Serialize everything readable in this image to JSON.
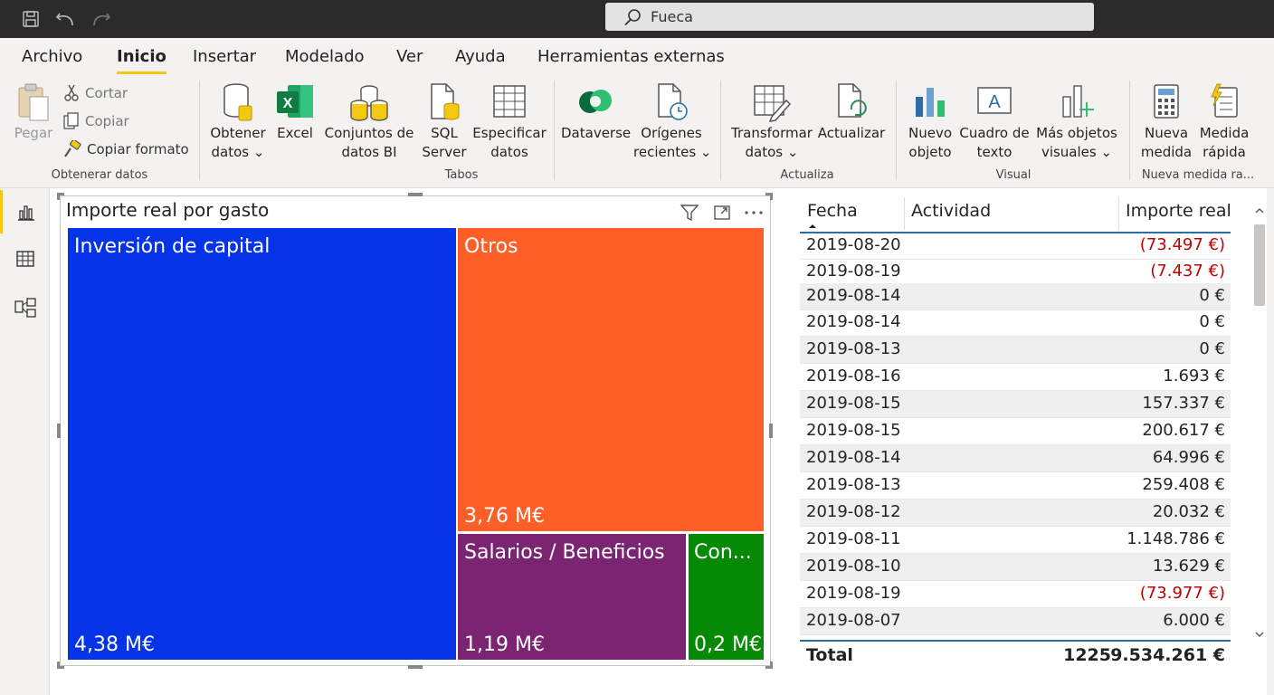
{
  "titlebar": {
    "search_text": "Fueca",
    "icons": [
      "save-icon",
      "undo-icon",
      "redo-icon",
      "search-icon"
    ]
  },
  "menu": {
    "tabs": [
      "Archivo",
      "Inicio",
      "Insertar",
      "Modelado",
      "Ver",
      "Ayuda",
      "Herramientas externas"
    ],
    "active": "Inicio"
  },
  "ribbon": {
    "clipboard": {
      "paste": "Pegar",
      "cut": "Cortar",
      "copy": "Copiar",
      "format_painter": "Copiar formato"
    },
    "get_data": {
      "l1": "Obtener",
      "l2": "datos ⌄"
    },
    "excel": "Excel",
    "datasets": {
      "l1": "Conjuntos de",
      "l2": "datos BI"
    },
    "sql": {
      "l1": "SQL",
      "l2": "Server"
    },
    "enter_data": {
      "l1": "Especificar",
      "l2": "datos"
    },
    "dataverse": "Dataverse",
    "recent": {
      "l1": "Orígenes",
      "l2": "recientes ⌄"
    },
    "transform": {
      "l1": "Transformar",
      "l2": "datos ⌄"
    },
    "refresh": "Actualizar",
    "new_visual": {
      "l1": "Nuevo",
      "l2": "objeto"
    },
    "textbox": {
      "l1": "Cuadro de",
      "l2": "texto"
    },
    "more_visuals": {
      "l1": "Más objetos",
      "l2": "visuales ⌄"
    },
    "new_measure": {
      "l1": "Nueva",
      "l2": "medida"
    },
    "quick_measure": {
      "l1": "Medida",
      "l2": "rápida"
    },
    "groups": {
      "data": "Obtenerar datos",
      "tables": "Tabos",
      "queries": "Actualiza",
      "visual": "Visual",
      "calc": "Nueva medida ra..."
    }
  },
  "visual": {
    "title": "Importe real por gasto",
    "icons": [
      "filter-icon",
      "focus-mode-icon",
      "more-options-icon"
    ]
  },
  "chart_data": {
    "type": "treemap",
    "title": "Importe real por gasto",
    "unit": "M€",
    "items": [
      {
        "name": "Inversión de capital",
        "label": "4,38 M€",
        "value": 4.38,
        "color": "#0533e8"
      },
      {
        "name": "Otros",
        "label": "3,76 M€",
        "value": 3.76,
        "color": "#fe5f27"
      },
      {
        "name": "Salarios / Beneficios",
        "label": "1,19 M€",
        "value": 1.19,
        "color": "#7b2472"
      },
      {
        "name": "Con...",
        "label": "0,2 M€",
        "value": 0.2,
        "color": "#068a06"
      }
    ]
  },
  "table": {
    "headers": [
      "Fecha",
      "Actividad",
      "Importe real"
    ],
    "rows": [
      {
        "fecha": "2019-08-20",
        "importe": "(73.497 €)",
        "neg": true
      },
      {
        "fecha": "2019-08-19",
        "importe": "(7.437 €)",
        "neg": true
      },
      {
        "fecha": "2019-08-14",
        "importe": "0 €",
        "neg": false
      },
      {
        "fecha": "2019-08-14",
        "importe": "0 €",
        "neg": false
      },
      {
        "fecha": "2019-08-13",
        "importe": "0 €",
        "neg": false
      },
      {
        "fecha": "2019-08-16",
        "importe": "1.693 €",
        "neg": false
      },
      {
        "fecha": "2019-08-15",
        "importe": "157.337 €",
        "neg": false
      },
      {
        "fecha": "2019-08-15",
        "importe": "200.617 €",
        "neg": false
      },
      {
        "fecha": "2019-08-14",
        "importe": "64.996 €",
        "neg": false
      },
      {
        "fecha": "2019-08-13",
        "importe": "259.408 €",
        "neg": false
      },
      {
        "fecha": "2019-08-12",
        "importe": "20.032 €",
        "neg": false
      },
      {
        "fecha": "2019-08-11",
        "importe": "1.148.786 €",
        "neg": false
      },
      {
        "fecha": "2019-08-10",
        "importe": "13.629 €",
        "neg": false
      },
      {
        "fecha": "2019-08-19",
        "importe": "(73.977 €)",
        "neg": true
      },
      {
        "fecha": "2019-08-07",
        "importe": "6.000 €",
        "neg": false
      }
    ],
    "total": {
      "label": "Total",
      "actividad": "1225",
      "importe": "9.534.261 €"
    }
  },
  "colors": {
    "accent": "#f2c811",
    "negative": "#c00000",
    "titlebar": "#2b2b2b"
  }
}
